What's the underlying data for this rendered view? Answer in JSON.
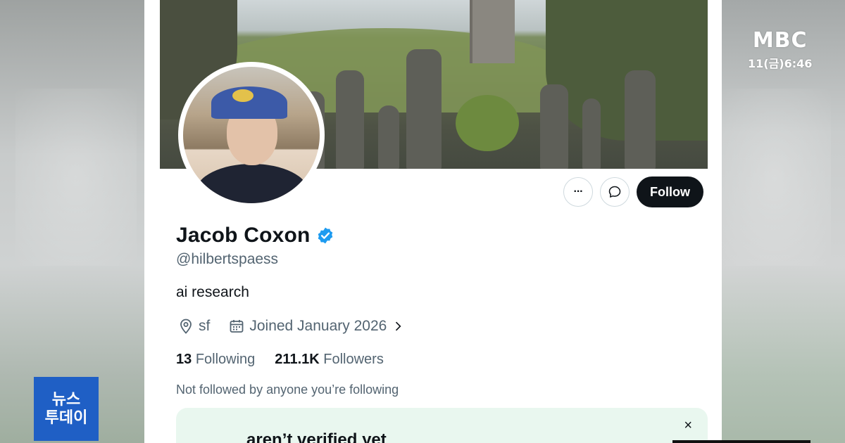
{
  "broadcast": {
    "logo": "MBC",
    "time": "11(금)6:46",
    "badge_line1": "뉴스",
    "badge_line2": "투데이"
  },
  "profile": {
    "name": "Jacob Coxon",
    "handle": "@hilbertspaess",
    "bio": "ai research",
    "location": "sf",
    "joined": "Joined January 2026",
    "following_count": "13",
    "following_label": "Following",
    "followers_count": "211.1K",
    "followers_label": "Followers",
    "not_followed_text": "Not followed by anyone you’re following"
  },
  "actions": {
    "more_label": "···",
    "follow_label": "Follow"
  },
  "promo": {
    "text": "aren’t verified yet",
    "close_label": "×"
  },
  "colors": {
    "accent_verified": "#1d9bf0",
    "follow_bg": "#0f1419",
    "promo_bg": "#e9f7ef",
    "badge_bg": "#1f5fc5"
  },
  "icons": [
    "more-icon",
    "message-icon",
    "verified-badge-icon",
    "location-icon",
    "calendar-icon",
    "chevron-right-icon",
    "close-icon"
  ]
}
